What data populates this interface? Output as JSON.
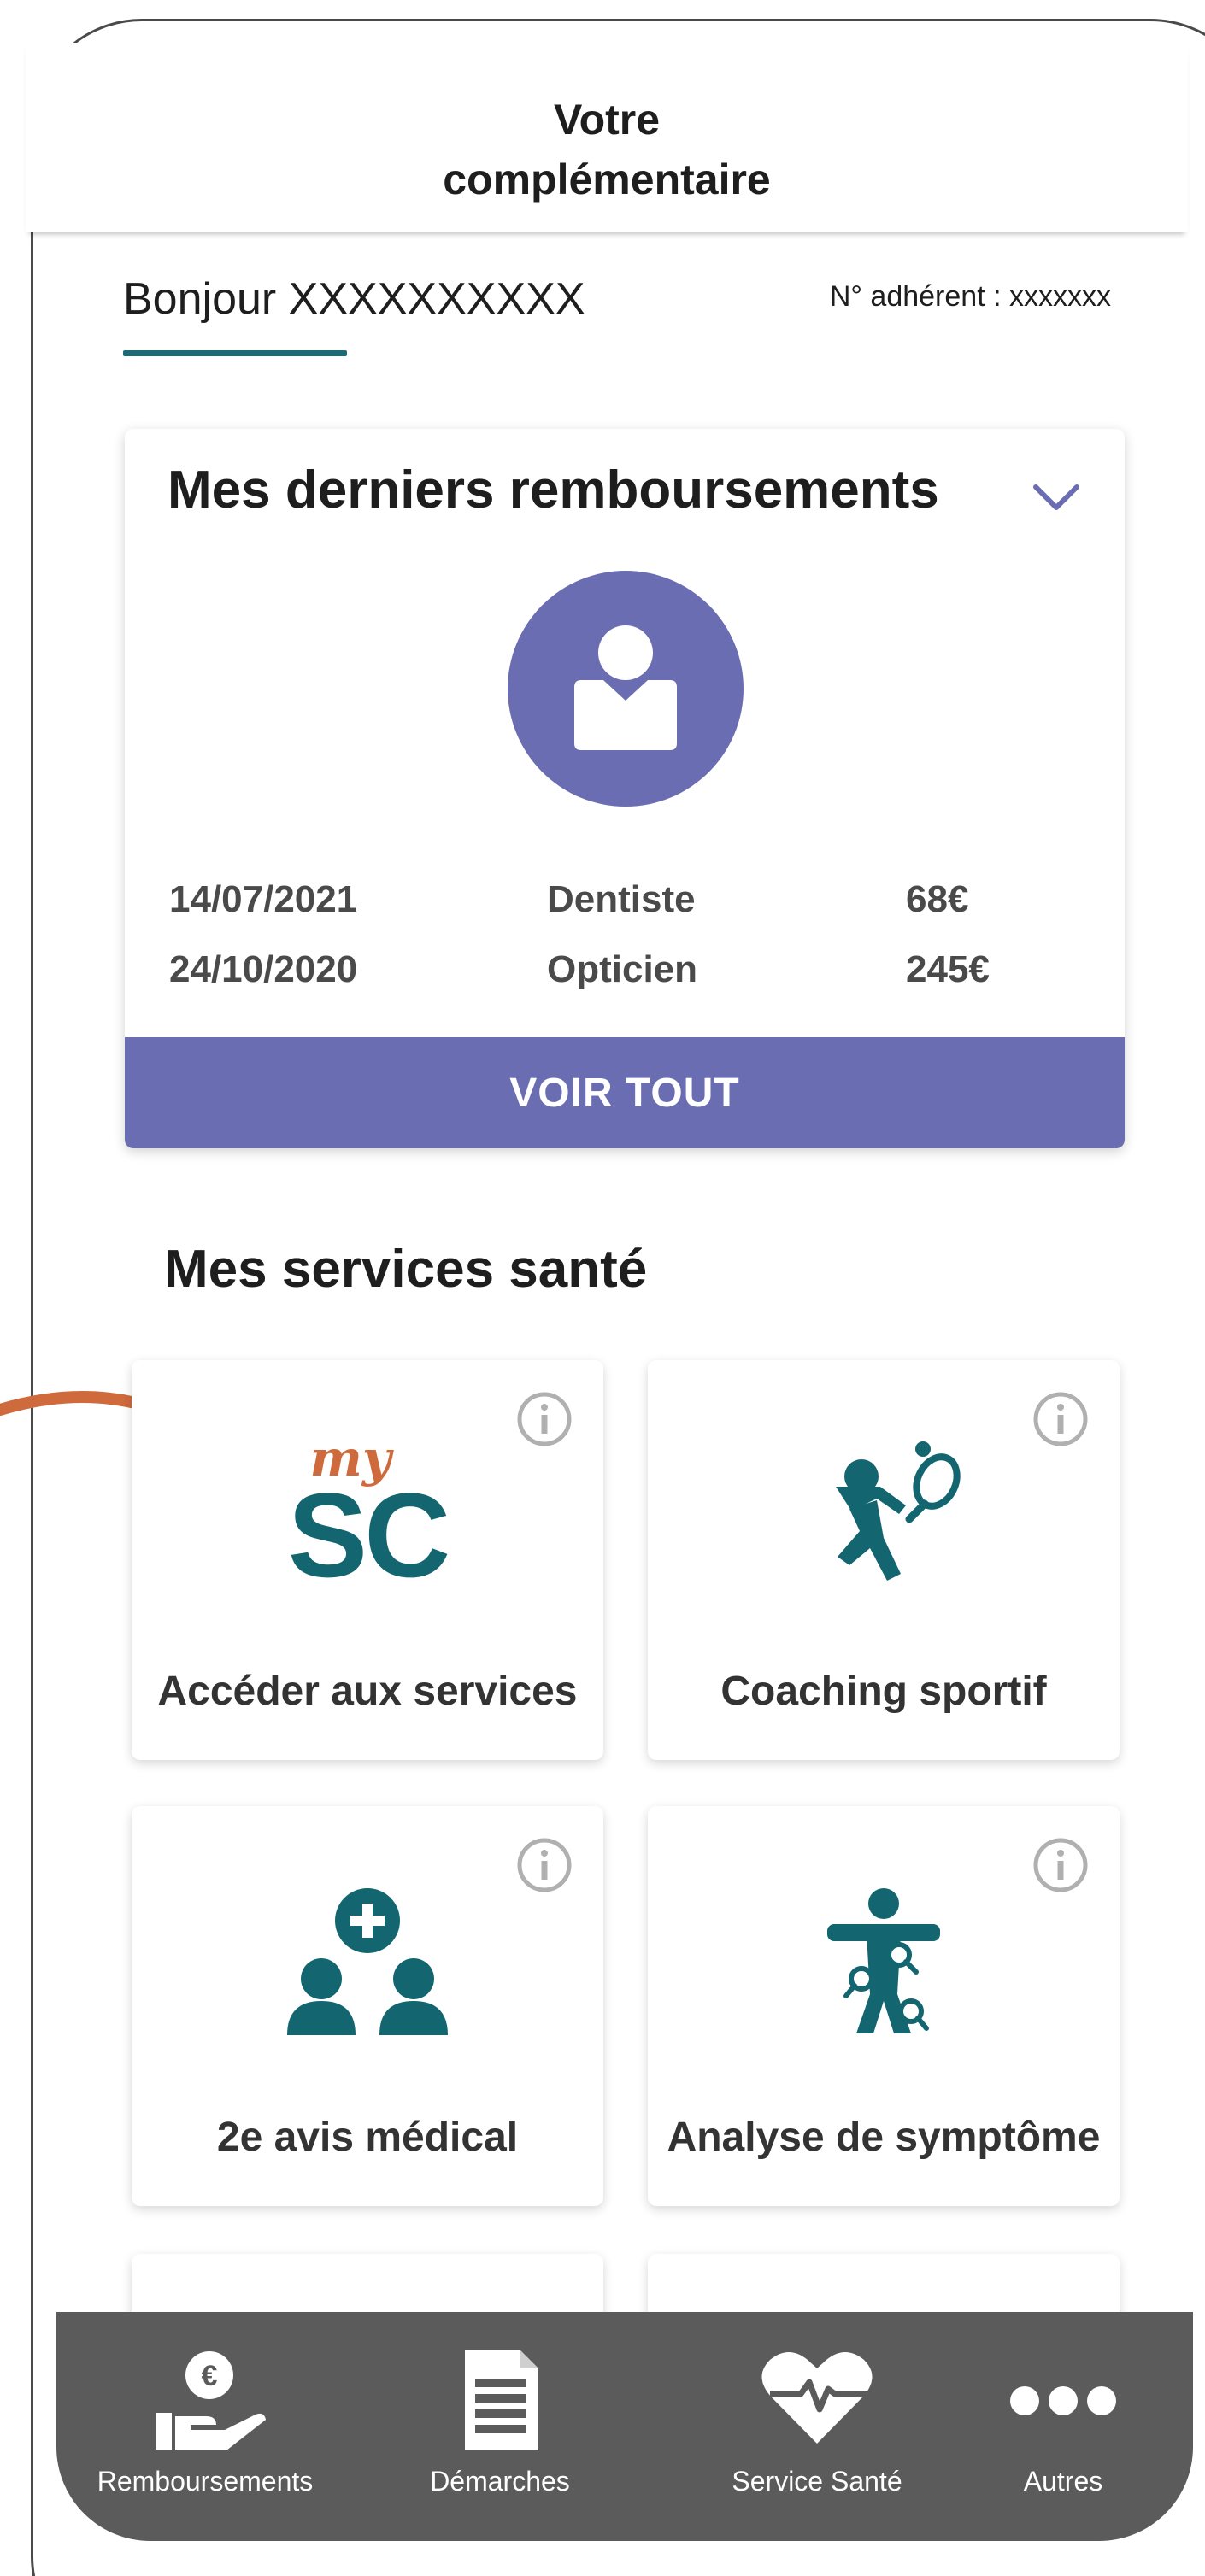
{
  "header": {
    "title_line1": "Votre",
    "title_line2": "complémentaire"
  },
  "greeting": {
    "text": "Bonjour XXXXXXXXXX",
    "member_label": "N° adhérent : xxxxxxx"
  },
  "reimbursements": {
    "title": "Mes derniers remboursements",
    "rows": [
      {
        "date": "14/07/2021",
        "category": "Dentiste",
        "amount": "68€"
      },
      {
        "date": "24/10/2020",
        "category": "Opticien",
        "amount": "245€"
      }
    ],
    "view_all_label": "VOIR TOUT"
  },
  "services": {
    "title": "Mes services santé",
    "tiles": [
      {
        "label": "Accéder aux services",
        "icon": "mysc-logo-icon",
        "logo_top": "my",
        "logo_main": "SC"
      },
      {
        "label": "Coaching sportif",
        "icon": "tennis-player-icon"
      },
      {
        "label": "2e avis médical",
        "icon": "medical-second-opinion-icon"
      },
      {
        "label": "Analyse de symptôme",
        "icon": "symptom-analysis-icon"
      }
    ]
  },
  "bottom_nav": [
    {
      "label": "Remboursements",
      "icon": "hand-euro-icon"
    },
    {
      "label": "Démarches",
      "icon": "document-icon"
    },
    {
      "label": "Service Santé",
      "icon": "heart-pulse-icon"
    },
    {
      "label": "Autres",
      "icon": "more-dots-icon"
    }
  ],
  "colors": {
    "accent_purple": "#6a6db1",
    "teal": "#136670",
    "orange": "#cf6a3c",
    "nav_bg": "#5b5b5b"
  }
}
